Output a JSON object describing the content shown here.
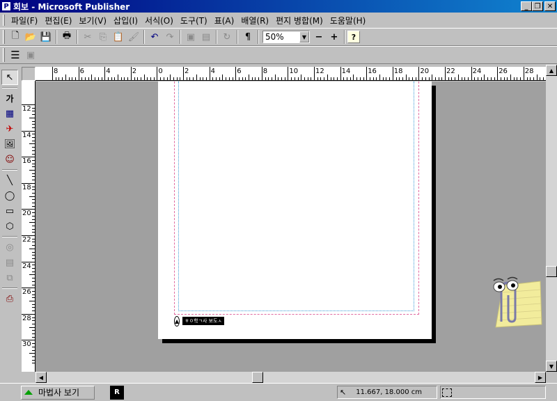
{
  "window": {
    "icon_letter": "P",
    "title": "회보 - Microsoft Publisher",
    "controls": {
      "minimize": "_",
      "restore": "❐",
      "close": "✕"
    }
  },
  "menubar": {
    "items": [
      {
        "label": "파일(F)"
      },
      {
        "label": "편집(E)"
      },
      {
        "label": "보기(V)"
      },
      {
        "label": "삽입(I)"
      },
      {
        "label": "서식(O)"
      },
      {
        "label": "도구(T)"
      },
      {
        "label": "표(A)"
      },
      {
        "label": "배열(R)"
      },
      {
        "label": "편지 병합(M)"
      },
      {
        "label": "도움말(H)"
      }
    ]
  },
  "toolbar": {
    "zoom_value": "50%",
    "icons": {
      "new": "🗋",
      "open": "📂",
      "save": "💾",
      "print": "🖶",
      "cut": "✂",
      "copy": "⎘",
      "paste": "📋",
      "format_painter": "🖌",
      "undo": "↶",
      "redo": "↷",
      "bring_front": "▣",
      "send_back": "▤",
      "rotate": "↻",
      "special_chars": "¶",
      "zoom_out": "−",
      "zoom_in": "+",
      "help": "?"
    }
  },
  "object_toolbar": {
    "icons": {
      "pointer": "↖",
      "text_frame": "가",
      "table_frame": "▦",
      "wordart": "✈",
      "picture_frame": "🖼",
      "clipart": "☺",
      "line": "╲",
      "oval": "◯",
      "rectangle": "▭",
      "custom_shape": "⬡",
      "design_gallery": "◎",
      "form": "▤",
      "object": "⧉",
      "web_tool": "⎙"
    }
  },
  "rulers": {
    "horizontal_labels": [
      "8",
      "6",
      "4",
      "2",
      "0",
      "2",
      "4",
      "6",
      "8",
      "10",
      "12",
      "14",
      "16",
      "18",
      "20",
      "22",
      "24",
      "26",
      "28"
    ],
    "vertical_labels": [
      "12",
      "14",
      "16",
      "18",
      "20",
      "22",
      "24",
      "26",
      "28",
      "30"
    ]
  },
  "document": {
    "footer_symbol": "▲",
    "footer_label": "ㅎㅇ학ㄱ사 보도ㅅ"
  },
  "statusbar": {
    "wizard_label": "마법사 보기",
    "page_label": "R",
    "position": "11.667, 18.000 cm",
    "size": ""
  },
  "scroll": {
    "up": "▲",
    "down": "▼",
    "left": "◀",
    "right": "▶"
  }
}
